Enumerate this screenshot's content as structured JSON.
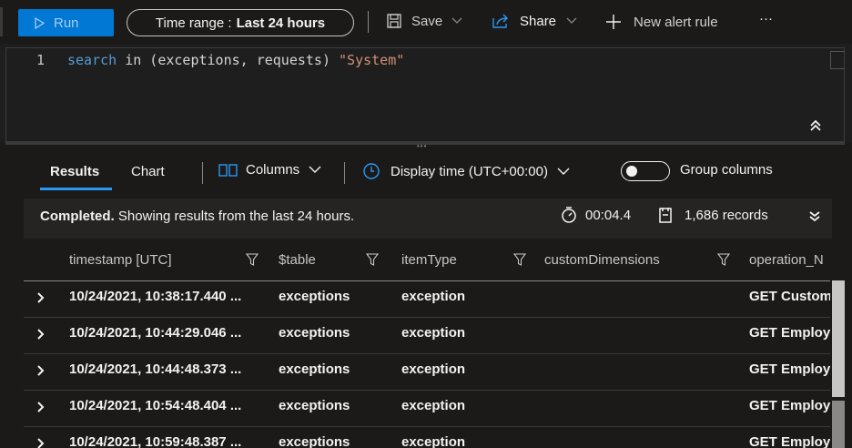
{
  "toolbar": {
    "run_label": "Run",
    "time_range_label": "Time range :",
    "time_range_value": "Last 24 hours",
    "save_label": "Save",
    "share_label": "Share",
    "new_alert_label": "New alert rule",
    "more_label": "···"
  },
  "editor": {
    "line_number": "1",
    "code_kw": "search",
    "code_mid": " in (exceptions, requests) ",
    "code_str": "\"System\""
  },
  "results": {
    "tabs": [
      "Results",
      "Chart"
    ],
    "columns_label": "Columns",
    "display_time_label": "Display time (UTC+00:00)",
    "group_columns_label": "Group columns",
    "status_bold": "Completed.",
    "status_text": " Showing results from the last 24 hours.",
    "duration": "00:04.4",
    "records": "1,686 records"
  },
  "grid": {
    "headers": [
      "timestamp [UTC]",
      "$table",
      "itemType",
      "customDimensions",
      "operation_N"
    ],
    "rows": [
      {
        "timestamp": "10/24/2021, 10:38:17.440 ...",
        "table": "exceptions",
        "itemType": "exception",
        "customDimensions": "",
        "operation": "GET Custom"
      },
      {
        "timestamp": "10/24/2021, 10:44:29.046 ...",
        "table": "exceptions",
        "itemType": "exception",
        "customDimensions": "",
        "operation": "GET Employ"
      },
      {
        "timestamp": "10/24/2021, 10:44:48.373 ...",
        "table": "exceptions",
        "itemType": "exception",
        "customDimensions": "",
        "operation": "GET Employ"
      },
      {
        "timestamp": "10/24/2021, 10:54:48.404 ...",
        "table": "exceptions",
        "itemType": "exception",
        "customDimensions": "",
        "operation": "GET Employ"
      },
      {
        "timestamp": "10/24/2021, 10:59:48.387 ...",
        "table": "exceptions",
        "itemType": "exception",
        "customDimensions": "",
        "operation": "GET Employ"
      }
    ]
  },
  "colors": {
    "accent": "#0078d4",
    "tab_underline": "#2899f5",
    "keyword": "#569cd6",
    "string": "#ce9178"
  },
  "icons": [
    "play-icon",
    "save-icon",
    "share-icon",
    "plus-icon",
    "more-icon",
    "collapse-up-icon",
    "columns-icon",
    "clock-icon",
    "timer-icon",
    "records-icon",
    "expand-all-icon",
    "filter-icon",
    "row-expand-icon"
  ]
}
